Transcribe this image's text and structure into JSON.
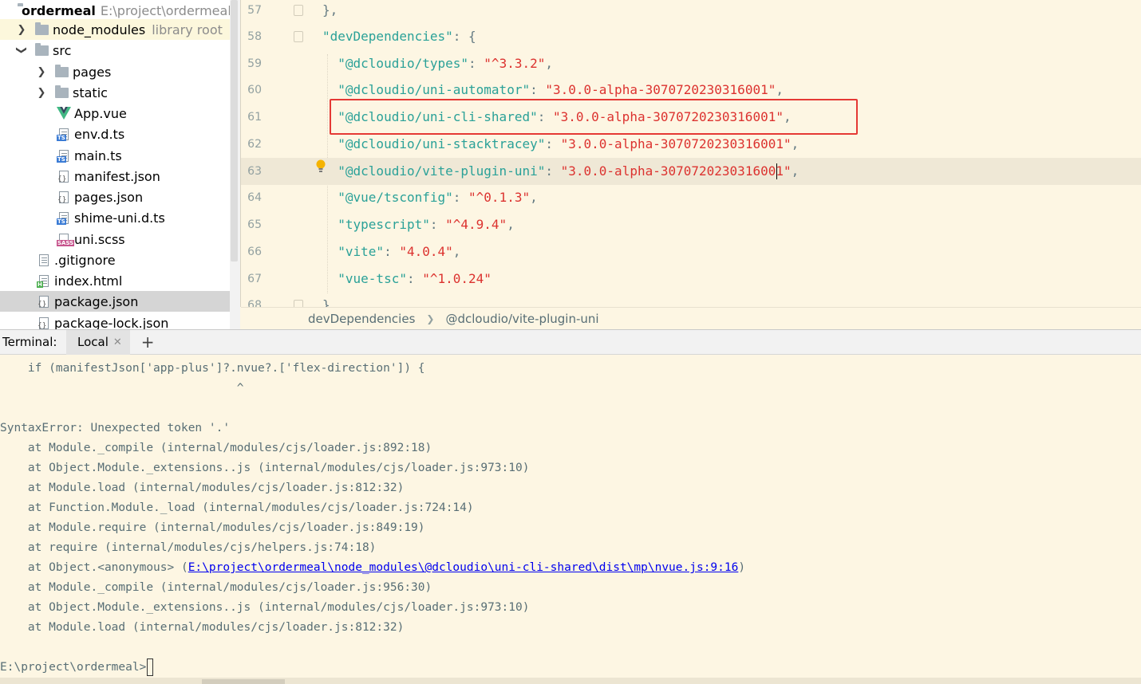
{
  "project_tree": {
    "root": {
      "name": "ordermeal",
      "path": "E:\\project\\ordermeal"
    },
    "items": [
      {
        "label": "node_modules",
        "hint": "library root"
      },
      {
        "label": "src"
      },
      {
        "label": "pages"
      },
      {
        "label": "static"
      },
      {
        "label": "App.vue"
      },
      {
        "label": "env.d.ts"
      },
      {
        "label": "main.ts"
      },
      {
        "label": "manifest.json"
      },
      {
        "label": "pages.json"
      },
      {
        "label": "shime-uni.d.ts"
      },
      {
        "label": "uni.scss"
      },
      {
        "label": ".gitignore"
      },
      {
        "label": "index.html"
      },
      {
        "label": "package.json"
      },
      {
        "label": "package-lock.json"
      }
    ]
  },
  "editor": {
    "lines": [
      {
        "num": "57",
        "parts": [
          {
            "t": "},",
            "c": "p"
          }
        ]
      },
      {
        "num": "58",
        "parts": [
          {
            "t": "\"devDependencies\"",
            "c": "k"
          },
          {
            "t": ": {",
            "c": "p"
          }
        ]
      },
      {
        "num": "59",
        "parts": [
          {
            "t": "  \"@dcloudio/types\"",
            "c": "k"
          },
          {
            "t": ": ",
            "c": "p"
          },
          {
            "t": "\"^3.3.2\"",
            "c": "s"
          },
          {
            "t": ",",
            "c": "p"
          }
        ]
      },
      {
        "num": "60",
        "parts": [
          {
            "t": "  \"@dcloudio/uni-automator\"",
            "c": "k"
          },
          {
            "t": ": ",
            "c": "p"
          },
          {
            "t": "\"3.0.0-alpha-3070720230316001\"",
            "c": "s"
          },
          {
            "t": ",",
            "c": "p"
          }
        ]
      },
      {
        "num": "61",
        "parts": [
          {
            "t": "  \"@dcloudio/uni-cli-shared\"",
            "c": "k"
          },
          {
            "t": ": ",
            "c": "p"
          },
          {
            "t": "\"3.0.0-alpha-3070720230316001\"",
            "c": "s"
          },
          {
            "t": ",",
            "c": "p"
          }
        ]
      },
      {
        "num": "62",
        "parts": [
          {
            "t": "  \"@dcloudio/uni-stacktracey\"",
            "c": "k"
          },
          {
            "t": ": ",
            "c": "p"
          },
          {
            "t": "\"3.0.0-alpha-3070720230316001\"",
            "c": "s"
          },
          {
            "t": ",",
            "c": "p"
          }
        ]
      },
      {
        "num": "63",
        "parts": [
          {
            "t": "  \"@dcloudio/vite-plugin-uni\"",
            "c": "k"
          },
          {
            "t": ": ",
            "c": "p"
          },
          {
            "t": "\"3.0.0-alpha-3070720230316001\"",
            "c": "s"
          },
          {
            "t": ",",
            "c": "p"
          }
        ]
      },
      {
        "num": "64",
        "parts": [
          {
            "t": "  \"@vue/tsconfig\"",
            "c": "k"
          },
          {
            "t": ": ",
            "c": "p"
          },
          {
            "t": "\"^0.1.3\"",
            "c": "s"
          },
          {
            "t": ",",
            "c": "p"
          }
        ]
      },
      {
        "num": "65",
        "parts": [
          {
            "t": "  \"typescript\"",
            "c": "k"
          },
          {
            "t": ": ",
            "c": "p"
          },
          {
            "t": "\"^4.9.4\"",
            "c": "s"
          },
          {
            "t": ",",
            "c": "p"
          }
        ]
      },
      {
        "num": "66",
        "parts": [
          {
            "t": "  \"vite\"",
            "c": "k"
          },
          {
            "t": ": ",
            "c": "p"
          },
          {
            "t": "\"4.0.4\"",
            "c": "s"
          },
          {
            "t": ",",
            "c": "p"
          }
        ]
      },
      {
        "num": "67",
        "parts": [
          {
            "t": "  \"vue-tsc\"",
            "c": "k"
          },
          {
            "t": ": ",
            "c": "p"
          },
          {
            "t": "\"^1.0.24\"",
            "c": "s"
          }
        ]
      },
      {
        "num": "68",
        "parts": [
          {
            "t": "}",
            "c": "p"
          }
        ]
      }
    ]
  },
  "breadcrumb": [
    "devDependencies",
    "@dcloudio/vite-plugin-uni"
  ],
  "terminal": {
    "title": "Terminal:",
    "tab": "Local",
    "lines": [
      "    if (manifestJson['app-plus']?.nvue?.['flex-direction']) {",
      "                                  ^",
      "",
      "SyntaxError: Unexpected token '.'",
      "    at Module._compile (internal/modules/cjs/loader.js:892:18)",
      "    at Object.Module._extensions..js (internal/modules/cjs/loader.js:973:10)",
      "    at Module.load (internal/modules/cjs/loader.js:812:32)",
      "    at Function.Module._load (internal/modules/cjs/loader.js:724:14)",
      "    at Module.require (internal/modules/cjs/loader.js:849:19)",
      "    at require (internal/modules/cjs/helpers.js:74:18)",
      {
        "pre": "    at Object.<anonymous> (",
        "link": "E:\\project\\ordermeal\\node_modules\\@dcloudio\\uni-cli-shared\\dist\\mp\\nvue.js:9:16",
        "post": ")"
      },
      "    at Module._compile (internal/modules/cjs/loader.js:956:30)",
      "    at Object.Module._extensions..js (internal/modules/cjs/loader.js:973:10)",
      "    at Module.load (internal/modules/cjs/loader.js:812:32)",
      ""
    ],
    "prompt": "E:\\project\\ordermeal>"
  },
  "colors": {
    "json_key": "#2aa198",
    "json_string": "#dc322f",
    "highlight_box": "#e53935",
    "link": "#0000ee"
  }
}
